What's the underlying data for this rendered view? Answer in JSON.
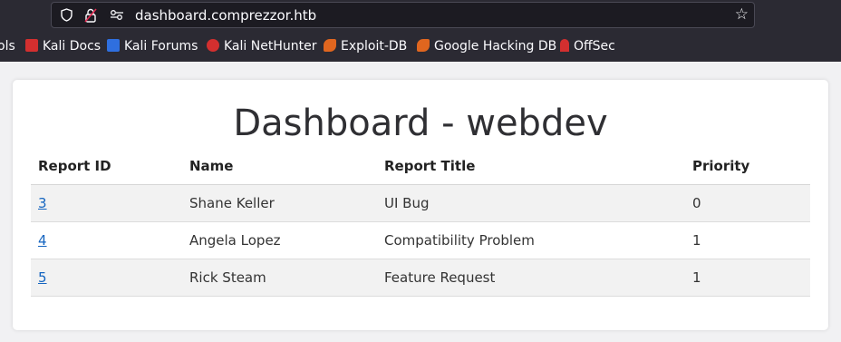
{
  "browser": {
    "url": "dashboard.comprezzor.htb",
    "bookmarks": [
      {
        "label": "ols",
        "icon": "folder-icon",
        "color": "#fbfbfe"
      },
      {
        "label": "Kali Docs",
        "icon": "kali-docs-icon",
        "color": "#d32f2f"
      },
      {
        "label": "Kali Forums",
        "icon": "kali-forums-icon",
        "color": "#2f6fdf"
      },
      {
        "label": "Kali NetHunter",
        "icon": "kali-nethunter-icon",
        "color": "#d32f2f"
      },
      {
        "label": "Exploit-DB",
        "icon": "exploit-db-icon",
        "color": "#e0661f"
      },
      {
        "label": "Google Hacking DB",
        "icon": "ghdb-icon",
        "color": "#e0661f"
      },
      {
        "label": "OffSec",
        "icon": "offsec-icon",
        "color": "#d32f2f"
      }
    ]
  },
  "page": {
    "title": "Dashboard - webdev",
    "columns": [
      "Report ID",
      "Name",
      "Report Title",
      "Priority"
    ],
    "rows": [
      {
        "id": "3",
        "name": "Shane Keller",
        "title": "UI Bug",
        "priority": "0"
      },
      {
        "id": "4",
        "name": "Angela Lopez",
        "title": "Compatibility Problem",
        "priority": "1"
      },
      {
        "id": "5",
        "name": "Rick Steam",
        "title": "Feature Request",
        "priority": "1"
      }
    ]
  },
  "colors": {
    "link": "#1565c0",
    "chrome": "#2b2a33"
  }
}
